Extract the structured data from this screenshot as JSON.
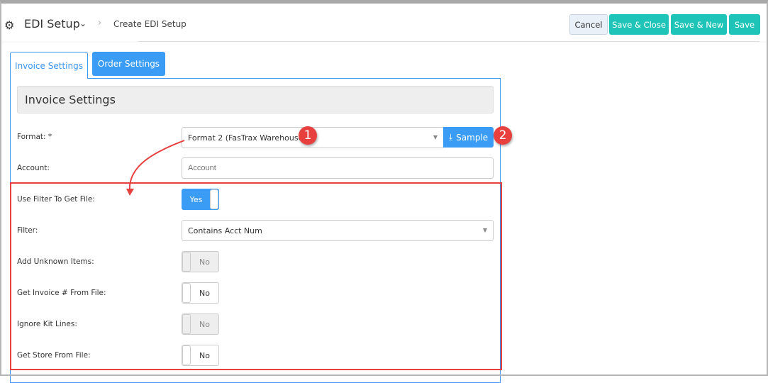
{
  "header": {
    "title": "EDI Setup",
    "breadcrumb": "Create EDI Setup"
  },
  "toolbar": {
    "cancel": "Cancel",
    "save_close": "Save & Close",
    "save_new": "Save & New",
    "save": "Save"
  },
  "tabs": [
    {
      "label": "Invoice Settings",
      "active": true
    },
    {
      "label": "Order Settings",
      "active": false
    }
  ],
  "section": {
    "title": "Invoice Settings"
  },
  "form": {
    "format": {
      "label": "Format: *",
      "value": "Format 2 (FasTrax Warehouse)",
      "sample_label": "Sample"
    },
    "account": {
      "label": "Account:",
      "placeholder": "Account"
    },
    "use_filter": {
      "label": "Use Filter To Get File:",
      "value": "Yes"
    },
    "filter": {
      "label": "Filter:",
      "value": "Contains Acct Num"
    },
    "add_unknown": {
      "label": "Add Unknown Items:",
      "value": "No"
    },
    "get_invoice": {
      "label": "Get Invoice # From File:",
      "value": "No"
    },
    "ignore_kit": {
      "label": "Ignore Kit Lines:",
      "value": "No"
    },
    "get_store": {
      "label": "Get Store From File:",
      "value": "No"
    }
  },
  "annotations": {
    "badge1": "1",
    "badge2": "2",
    "color": "#e8403f"
  }
}
